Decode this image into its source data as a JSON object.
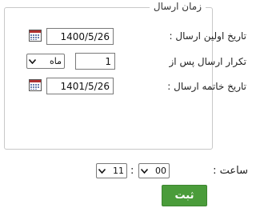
{
  "schedule": {
    "legend": "زمان ارسال",
    "first_send_label": "تاریخ اولین ارسال :",
    "first_send_value": "1400/5/26",
    "repeat_label": "تکرار ارسال پس از",
    "repeat_value": "1",
    "repeat_unit": "ماه",
    "end_label": "تاریخ خاتمه ارسال :",
    "end_value": "1401/5/26"
  },
  "time": {
    "label": "ساعت :",
    "minute": "00",
    "separator": ":",
    "hour": "11"
  },
  "submit_label": "ثبت",
  "icons": {
    "calendar": "calendar-icon",
    "dropdown": "chevron-down-icon"
  },
  "colors": {
    "submit_bg": "#4a9c3a",
    "calendar_header": "#b03030"
  }
}
